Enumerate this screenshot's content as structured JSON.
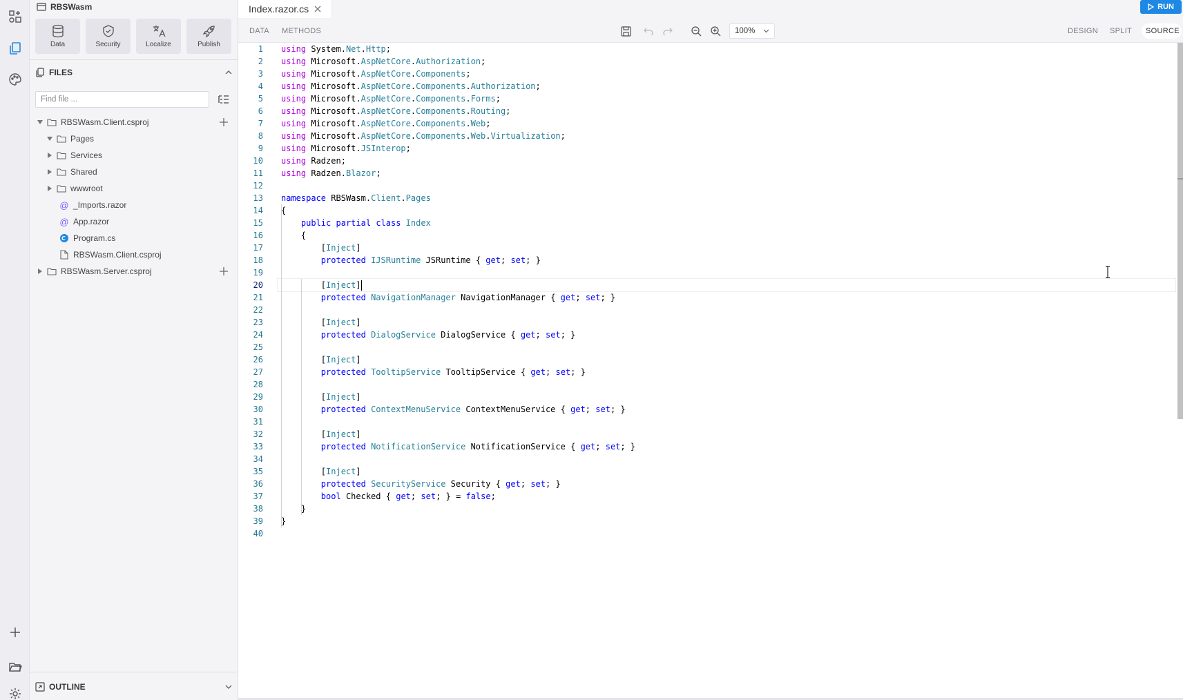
{
  "project": {
    "name": "RBSWasm"
  },
  "tools": [
    {
      "label": "Data",
      "icon": "database-icon"
    },
    {
      "label": "Security",
      "icon": "shield-icon"
    },
    {
      "label": "Localize",
      "icon": "translate-icon"
    },
    {
      "label": "Publish",
      "icon": "rocket-icon"
    }
  ],
  "files": {
    "header": "FILES",
    "search_placeholder": "Find file ...",
    "tree": [
      {
        "label": "RBSWasm.Client.csproj",
        "type": "folder",
        "expanded": true
      },
      {
        "label": "Pages",
        "type": "folder",
        "expanded": true
      },
      {
        "label": "Services",
        "type": "folder",
        "expanded": false
      },
      {
        "label": "Shared",
        "type": "folder",
        "expanded": false
      },
      {
        "label": "wwwroot",
        "type": "folder",
        "expanded": false
      },
      {
        "label": "_Imports.razor",
        "type": "razor"
      },
      {
        "label": "App.razor",
        "type": "razor"
      },
      {
        "label": "Program.cs",
        "type": "csharp"
      },
      {
        "label": "RBSWasm.Client.csproj",
        "type": "file"
      },
      {
        "label": "RBSWasm.Server.csproj",
        "type": "folder",
        "expanded": false
      }
    ]
  },
  "outline": {
    "header": "OUTLINE"
  },
  "tab": {
    "label": "Index.razor.cs"
  },
  "run": {
    "label": "RUN"
  },
  "toolbar": {
    "data_label": "DATA",
    "methods_label": "METHODS",
    "zoom": "100%",
    "design_label": "DESIGN",
    "split_label": "SPLIT",
    "source_label": "SOURCE"
  },
  "editor": {
    "current_line": 20,
    "line_numbers": [
      "1",
      "2",
      "3",
      "4",
      "5",
      "6",
      "7",
      "8",
      "9",
      "10",
      "11",
      "12",
      "13",
      "14",
      "15",
      "16",
      "17",
      "18",
      "19",
      "20",
      "21",
      "22",
      "23",
      "24",
      "25",
      "26",
      "27",
      "28",
      "29",
      "30",
      "31",
      "32",
      "33",
      "34",
      "35",
      "36",
      "37",
      "38",
      "39",
      "40"
    ],
    "lines": [
      "using System.Net.Http;",
      "using Microsoft.AspNetCore.Authorization;",
      "using Microsoft.AspNetCore.Components;",
      "using Microsoft.AspNetCore.Components.Authorization;",
      "using Microsoft.AspNetCore.Components.Forms;",
      "using Microsoft.AspNetCore.Components.Routing;",
      "using Microsoft.AspNetCore.Components.Web;",
      "using Microsoft.AspNetCore.Components.Web.Virtualization;",
      "using Microsoft.JSInterop;",
      "using Radzen;",
      "using Radzen.Blazor;",
      "",
      "namespace RBSWasm.Client.Pages",
      "{",
      "    public partial class Index",
      "    {",
      "        [Inject]",
      "        protected IJSRuntime JSRuntime { get; set; }",
      "",
      "        [Inject]",
      "        protected NavigationManager NavigationManager { get; set; }",
      "",
      "        [Inject]",
      "        protected DialogService DialogService { get; set; }",
      "",
      "        [Inject]",
      "        protected TooltipService TooltipService { get; set; }",
      "",
      "        [Inject]",
      "        protected ContextMenuService ContextMenuService { get; set; }",
      "",
      "        [Inject]",
      "        protected NotificationService NotificationService { get; set; }",
      "",
      "        [Inject]",
      "        protected SecurityService Security { get; set; }",
      "        bool Checked { get; set; } = false;",
      "    }",
      "}",
      ""
    ]
  },
  "colors": {
    "accent": "#1e88e5",
    "keyword": "#0000ff",
    "keyword_control": "#af00db",
    "type": "#267f99",
    "line_number": "#237893"
  }
}
